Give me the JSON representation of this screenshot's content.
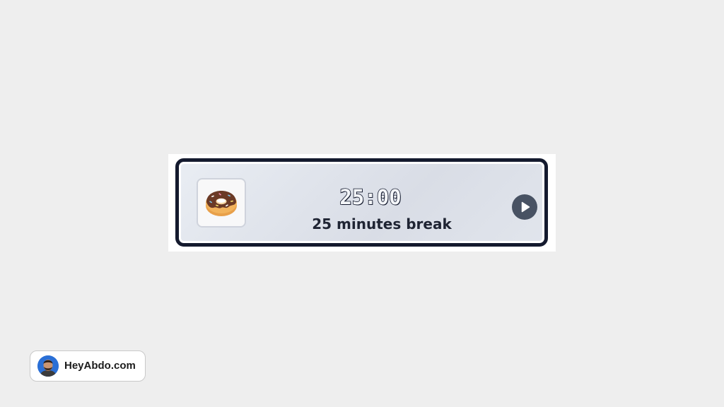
{
  "timer": {
    "time": "25:00",
    "label": "25 minutes break",
    "emoji": "donut-icon",
    "play_button": "play-icon"
  },
  "brand": {
    "name": "HeyAbdo.com",
    "avatar": "avatar"
  },
  "colors": {
    "background": "#eeeeee",
    "card_border": "#141a2e",
    "card_fill": "#dfe3ea",
    "play_button": "#485263",
    "text_dark": "#1f2433"
  }
}
